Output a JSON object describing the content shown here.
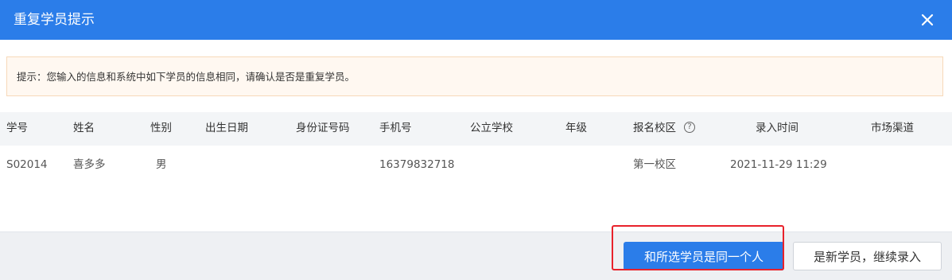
{
  "dialog": {
    "title": "重复学员提示",
    "notice": "提示：您输入的信息和系统中如下学员的信息相同，请确认是否是重复学员。"
  },
  "table": {
    "columns": [
      "学号",
      "姓名",
      "性别",
      "出生日期",
      "身份证号码",
      "手机号",
      "公立学校",
      "年级",
      "报名校区",
      "录入时间",
      "市场渠道"
    ],
    "rows": [
      {
        "student_id": "S02014",
        "name": "喜多多",
        "gender": "男",
        "birth_date": "",
        "id_number": "",
        "phone": "16379832718",
        "public_school": "",
        "grade": "",
        "campus": "第一校区",
        "entry_time": "2021-11-29 11:29",
        "channel": ""
      }
    ]
  },
  "buttons": {
    "same_person": "和所选学员是同一个人",
    "new_student": "是新学员，继续录入"
  },
  "icons": {
    "close": "close-icon",
    "help": "help-circle-icon"
  },
  "colors": {
    "primary": "#2b7de9",
    "highlight": "#e8222b",
    "notice_bg": "#fff8f1"
  }
}
